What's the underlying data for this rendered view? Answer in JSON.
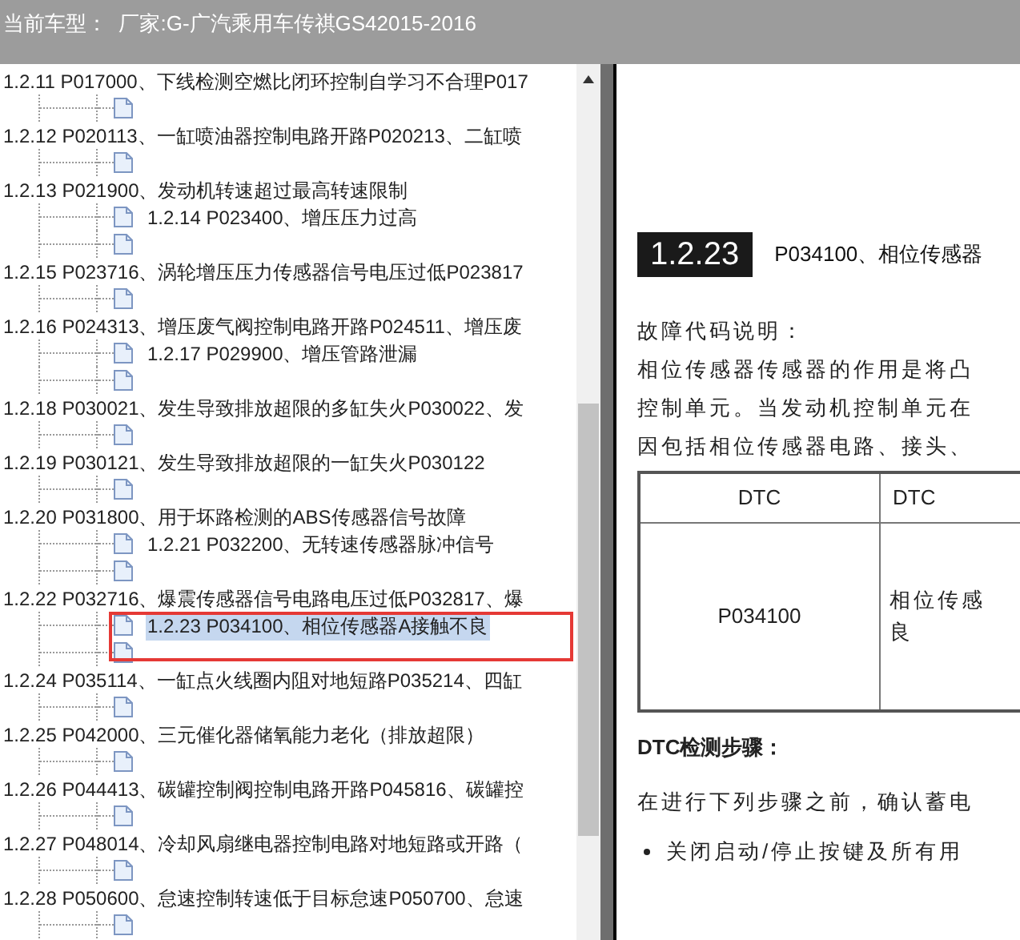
{
  "window": {
    "title": "当前车型：  厂家:G-广汽乘用车传祺GS42015-2016"
  },
  "tree": [
    {
      "label": "1.2.11 P017000、下线检测空燃比闭环控制自学习不合理P017"
    },
    {
      "label": "1.2.12 P020113、一缸喷油器控制电路开路P020213、二缸喷"
    },
    {
      "label": "1.2.13 P021900、发动机转速超过最高转速限制",
      "children": [
        {
          "label": "1.2.14 P023400、增压压力过高",
          "selected": false
        }
      ]
    },
    {
      "label": "1.2.15 P023716、涡轮增压压力传感器信号电压过低P023817"
    },
    {
      "label": "1.2.16 P024313、增压废气阀控制电路开路P024511、增压废",
      "children": [
        {
          "label": "1.2.17 P029900、增压管路泄漏",
          "selected": false
        }
      ]
    },
    {
      "label": "1.2.18 P030021、发生导致排放超限的多缸失火P030022、发"
    },
    {
      "label": "1.2.19 P030121、发生导致排放超限的一缸失火P030122"
    },
    {
      "label": "1.2.20 P031800、用于坏路检测的ABS传感器信号故障",
      "children": [
        {
          "label": "1.2.21 P032200、无转速传感器脉冲信号",
          "selected": false
        }
      ]
    },
    {
      "label": "1.2.22 P032716、爆震传感器信号电路电压过低P032817、爆",
      "children": [
        {
          "label": "1.2.23 P034100、相位传感器A接触不良",
          "selected": true
        }
      ]
    },
    {
      "label": "1.2.24 P035114、一缸点火线圈内阻对地短路P035214、四缸"
    },
    {
      "label": "1.2.25 P042000、三元催化器储氧能力老化（排放超限）"
    },
    {
      "label": "1.2.26 P044413、碳罐控制阀控制电路开路P045816、碳罐控"
    },
    {
      "label": "1.2.27 P048014、冷却风扇继电器控制电路对地短路或开路（"
    },
    {
      "label": "1.2.28 P050600、怠速控制转速低于目标怠速P050700、怠速"
    }
  ],
  "document": {
    "section_number": "1.2.23",
    "section_title": "P034100、相位传感器",
    "description_heading": "故障代码说明：",
    "description_lines": [
      "相位传感器传感器的作用是将凸",
      "控制单元。当发动机控制单元在",
      "因包括相位传感器电路、接头、"
    ],
    "table": {
      "columns": [
        "DTC",
        "DTC"
      ],
      "rows": [
        [
          "P034100",
          "相位传感良"
        ]
      ]
    },
    "steps_heading": "DTC检测步骤：",
    "steps_intro": "在进行下列步骤之前，确认蓄电",
    "bullets": [
      "关闭启动/停止按键及所有用"
    ]
  }
}
